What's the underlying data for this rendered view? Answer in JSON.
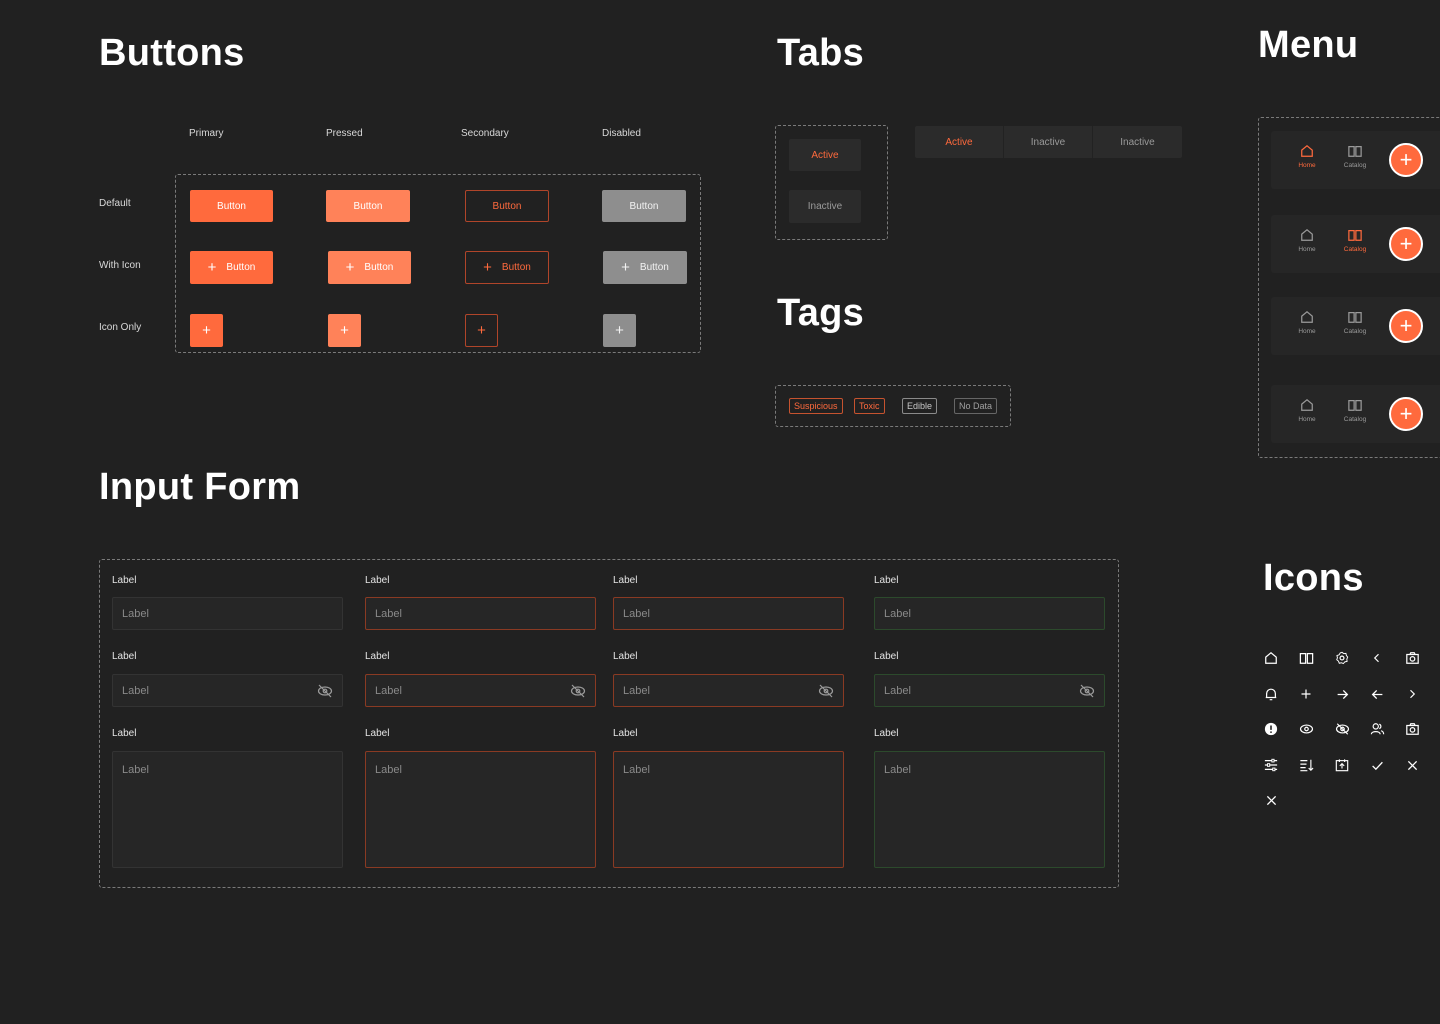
{
  "sections": {
    "buttons": "Buttons",
    "tabs": "Tabs",
    "menu": "Menu",
    "tags": "Tags",
    "input_form": "Input Form",
    "icons": "Icons"
  },
  "buttons": {
    "columns": [
      "Primary",
      "Pressed",
      "Secondary",
      "Disabled"
    ],
    "rows": [
      "Default",
      "With Icon",
      "Icon Only"
    ],
    "label": "Button"
  },
  "tabs": {
    "vertical": [
      "Active",
      "Inactive"
    ],
    "horizontal": [
      "Active",
      "Inactive",
      "Inactive"
    ]
  },
  "tags": [
    "Suspicious",
    "Toxic",
    "Edible",
    "No Data"
  ],
  "menu": {
    "items": [
      "Home",
      "Catalog"
    ]
  },
  "form": {
    "label": "Label",
    "placeholder": "Label"
  },
  "colors": {
    "background": "#212121",
    "accent": "#ff6a3d",
    "disabled": "#8e8e8e",
    "success_border": "#2c4a2c"
  },
  "icons": [
    "home-icon",
    "book-icon",
    "settings-gear-icon",
    "chevron-left-icon",
    "camera-icon",
    "bell-icon",
    "plus-icon",
    "arrow-right-icon",
    "arrow-left-icon",
    "chevron-right-icon",
    "alert-circle-icon",
    "eye-icon",
    "eye-off-icon",
    "users-icon",
    "camera-icon",
    "sliders-icon",
    "sort-icon",
    "calendar-add-icon",
    "check-icon",
    "close-icon",
    "close-icon"
  ]
}
